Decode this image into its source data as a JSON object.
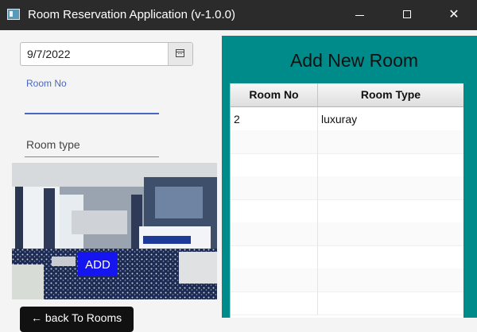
{
  "window": {
    "title": "Room Reservation Application (v-1.0.0)"
  },
  "form": {
    "date_value": "9/7/2022",
    "room_no_label": "Room No",
    "room_no_value": "",
    "room_type_placeholder": "Room type",
    "add_label": "ADD",
    "back_label": "← back To Rooms"
  },
  "panel": {
    "title": "Add New Room",
    "background": "#008b8b",
    "columns": [
      "Room No",
      "Room Type"
    ],
    "rows": [
      {
        "room_no": "2",
        "room_type": "luxuray"
      }
    ]
  },
  "colors": {
    "add_button": "#1515f0",
    "accent": "#4a66c2"
  }
}
